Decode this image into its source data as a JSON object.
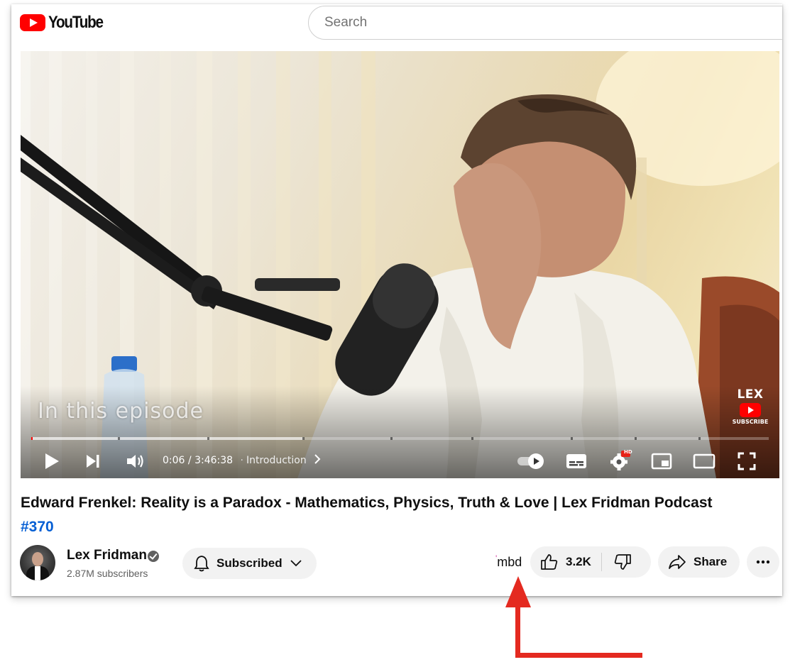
{
  "header": {
    "logo_text": "YouTube",
    "search_placeholder": "Search"
  },
  "player": {
    "overlay_text": "In this episode",
    "corner_badge": {
      "title": "LEX",
      "caption": "SUBSCRIBE"
    },
    "current_time": "0:06",
    "duration": "3:46:38",
    "time_separator": " / ",
    "chapter_label": "Introduction",
    "progress_played_fraction": 0.0005,
    "progress_buffered_fraction": 0.37,
    "hd_badge": "HD",
    "icons": [
      "play-icon",
      "next-icon",
      "volume-icon",
      "autoplay-toggle-icon",
      "subtitles-icon",
      "settings-icon",
      "miniplayer-icon",
      "theater-mode-icon",
      "fullscreen-icon"
    ]
  },
  "video": {
    "title": "Edward Frenkel: Reality is a Paradox - Mathematics, Physics, Truth & Love | Lex Fridman Podcast",
    "hashtag": "#370"
  },
  "channel": {
    "name": "Lex Fridman",
    "subscribers": "2.87M subscribers",
    "subscribe_label": "Subscribed"
  },
  "actions": {
    "extension_label": "mbd",
    "like_count": "3.2K",
    "share_label": "Share"
  },
  "colors": {
    "brand_red": "#ff0000",
    "link_blue": "#065fd4",
    "pill_bg": "#f2f2f2",
    "annotation_red": "#e42a20"
  }
}
